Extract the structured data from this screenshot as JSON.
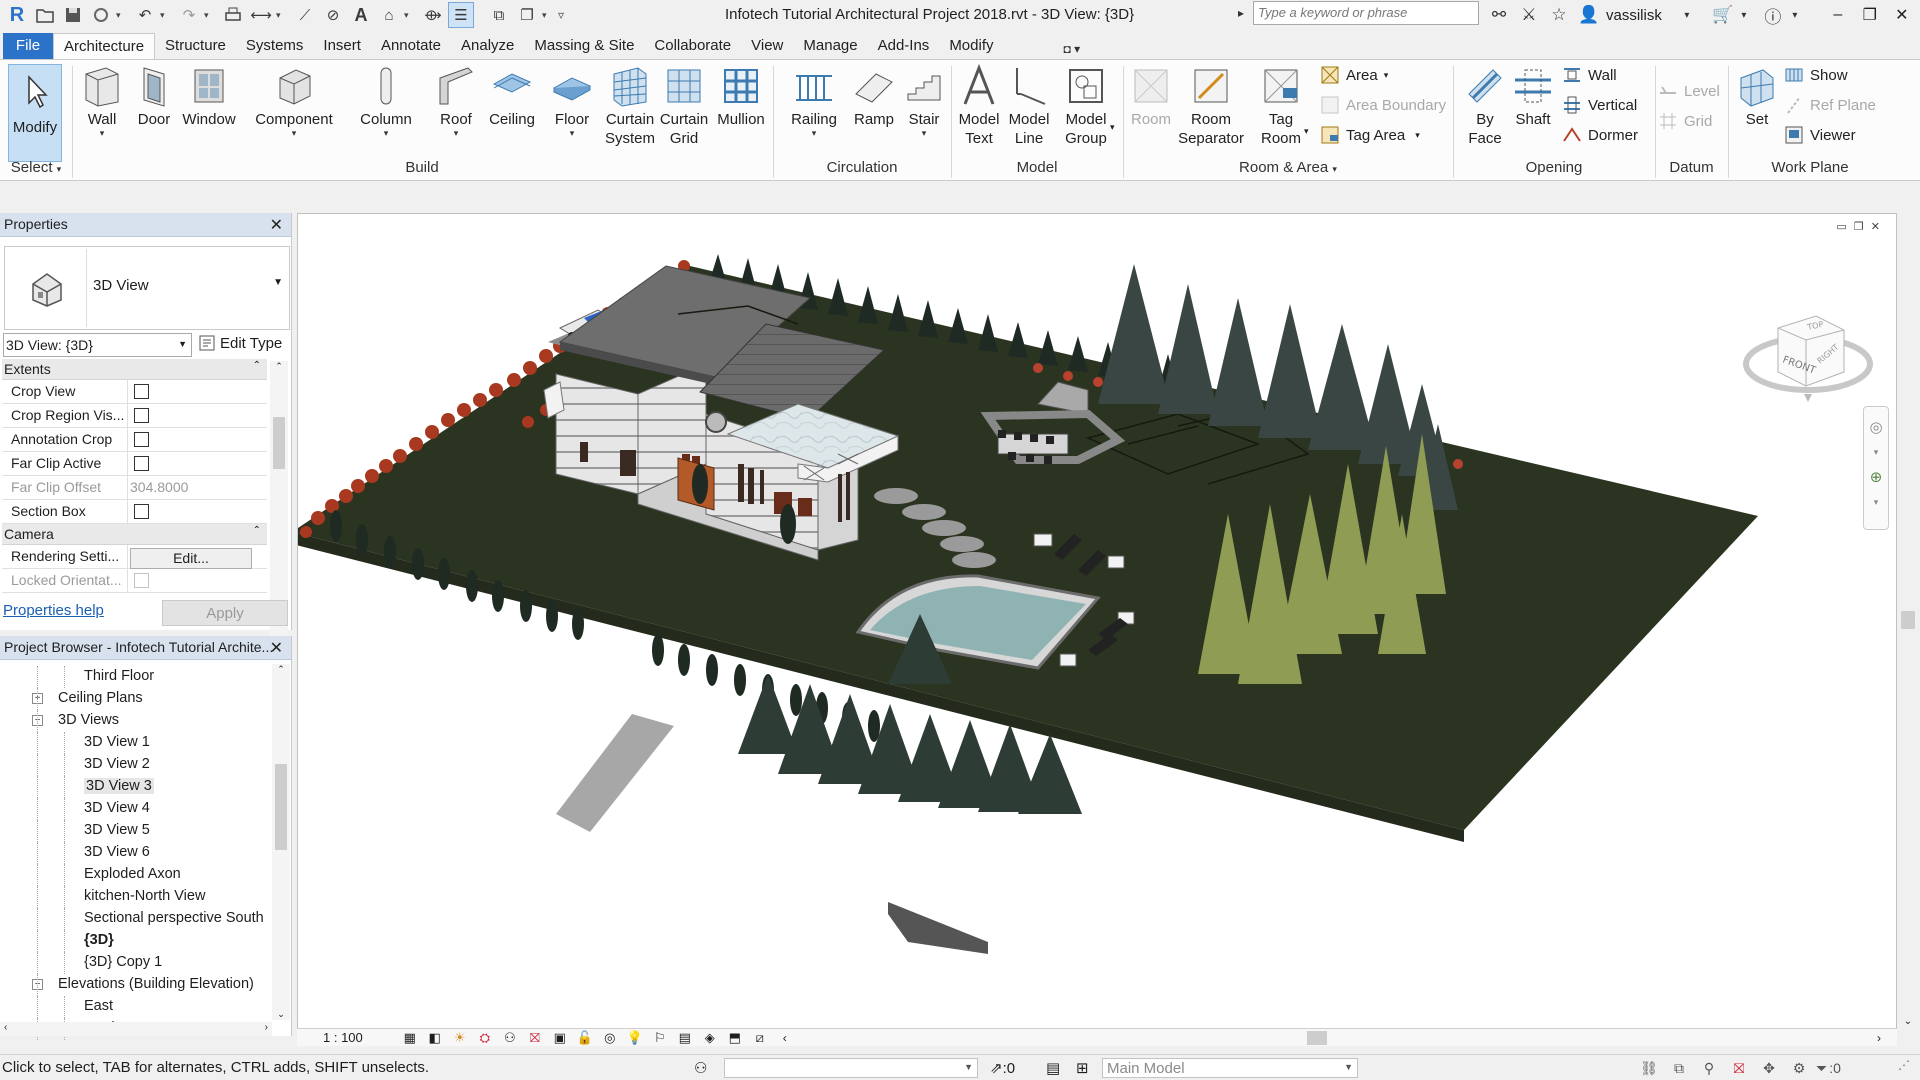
{
  "app": {
    "title": "Infotech Tutorial Architectural Project 2018.rvt - 3D View: {3D}",
    "search_placeholder": "Type a keyword or phrase",
    "username": "vassilisk"
  },
  "quick_access": [
    "revit-logo",
    "open",
    "save",
    "sync",
    "undo",
    "redo",
    "print",
    "measure",
    "tag",
    "text",
    "3d-view",
    "thin-lines",
    "close-views",
    "switch-windows",
    "customize"
  ],
  "tabs": [
    "File",
    "Architecture",
    "Structure",
    "Systems",
    "Insert",
    "Annotate",
    "Analyze",
    "Massing & Site",
    "Collaborate",
    "View",
    "Manage",
    "Add-Ins",
    "Modify"
  ],
  "active_tab": "Architecture",
  "ribbon": {
    "select": {
      "modify": "Modify",
      "panel": "Select"
    },
    "build": {
      "panel": "Build",
      "buttons": [
        "Wall",
        "Door",
        "Window",
        "Component",
        "Column",
        "Roof",
        "Ceiling",
        "Floor"
      ],
      "curtain_system": [
        "Curtain",
        "System"
      ],
      "curtain_grid": [
        "Curtain",
        "Grid"
      ],
      "mullion": "Mullion"
    },
    "circulation": {
      "panel": "Circulation",
      "buttons": [
        "Railing",
        "Ramp",
        "Stair"
      ]
    },
    "model": {
      "panel": "Model",
      "model_text": [
        "Model",
        "Text"
      ],
      "model_line": [
        "Model",
        "Line"
      ],
      "model_group": [
        "Model",
        "Group"
      ]
    },
    "room_area": {
      "panel": "Room & Area",
      "room": "Room",
      "room_separator": [
        "Room",
        "Separator"
      ],
      "tag_room": [
        "Tag",
        "Room"
      ],
      "area": "Area",
      "area_boundary": "Area  Boundary",
      "tag_area": "Tag  Area"
    },
    "opening": {
      "panel": "Opening",
      "by_face": [
        "By",
        "Face"
      ],
      "shaft": "Shaft",
      "wall": "Wall",
      "vertical": "Vertical",
      "dormer": "Dormer"
    },
    "datum": {
      "panel": "Datum",
      "level": "Level",
      "grid": "Grid"
    },
    "work_plane": {
      "panel": "Work Plane",
      "set": "Set",
      "show": "Show",
      "ref_plane": "Ref  Plane",
      "viewer": "Viewer"
    }
  },
  "properties": {
    "title": "Properties",
    "type_name": "3D View",
    "instance": "3D View: {3D}",
    "edit_type": "Edit Type",
    "categories": {
      "extents": "Extents",
      "camera": "Camera"
    },
    "rows": [
      {
        "name": "Crop View",
        "checked": false
      },
      {
        "name": "Crop Region Vis...",
        "checked": false
      },
      {
        "name": "Annotation Crop",
        "checked": false
      },
      {
        "name": "Far Clip Active",
        "checked": false
      },
      {
        "name": "Far Clip Offset",
        "value": "304.8000"
      },
      {
        "name": "Section Box",
        "checked": false
      }
    ],
    "camera_rows": [
      {
        "name": "Rendering Setti...",
        "button": "Edit..."
      },
      {
        "name": "Locked Orientat...",
        "checked": false
      }
    ],
    "help": "Properties help",
    "apply": "Apply"
  },
  "browser": {
    "title": "Project Browser - Infotech Tutorial Archite...",
    "items": [
      {
        "label": "Third Floor",
        "level": 2
      },
      {
        "label": "Ceiling Plans",
        "level": 1,
        "toggle": "+"
      },
      {
        "label": "3D Views",
        "level": 1,
        "toggle": "−"
      },
      {
        "label": "3D View 1",
        "level": 2
      },
      {
        "label": "3D View 2",
        "level": 2
      },
      {
        "label": "3D View 3",
        "level": 2,
        "selected": true
      },
      {
        "label": "3D View 4",
        "level": 2
      },
      {
        "label": "3D View 5",
        "level": 2
      },
      {
        "label": "3D View 6",
        "level": 2
      },
      {
        "label": "Exploded Axon",
        "level": 2
      },
      {
        "label": "kitchen-North View",
        "level": 2
      },
      {
        "label": "Sectional perspective South",
        "level": 2
      },
      {
        "label": "{3D}",
        "level": 2,
        "bold": true
      },
      {
        "label": "{3D} Copy 1",
        "level": 2
      },
      {
        "label": "Elevations (Building Elevation)",
        "level": 1,
        "toggle": "−"
      },
      {
        "label": "East",
        "level": 2
      },
      {
        "label": "North",
        "level": 2
      }
    ]
  },
  "viewcube": {
    "top": "TOP",
    "front": "FRONT",
    "right": "RIGHT"
  },
  "view_bar": {
    "scale": "1 : 100"
  },
  "status": {
    "message": "Click to select, TAB for alternates, CTRL adds, SHIFT unselects.",
    "selected_count": ":0",
    "model": "Main Model",
    "filter_count": ":0"
  },
  "colors": {
    "ribbon_file": "#2b73c8",
    "grass": "#2b3420",
    "pool": "#8fb3b3",
    "roof": "#6f6f6f",
    "brick_red": "#b8422e",
    "tree_dark": "#2e3c36",
    "tree_yellow": "#9aa85a"
  }
}
